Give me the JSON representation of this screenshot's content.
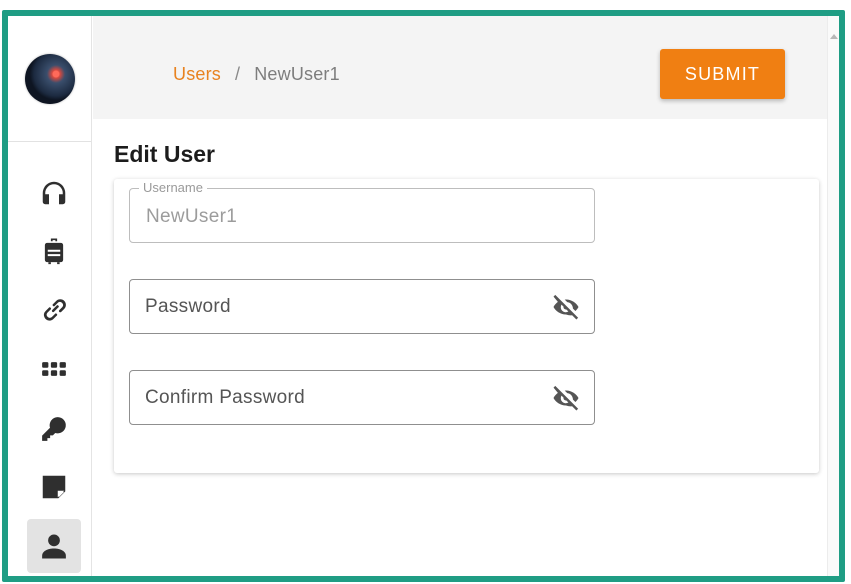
{
  "breadcrumb": {
    "root": "Users",
    "separator": "/",
    "current": "NewUser1"
  },
  "header": {
    "submit_label": "SUBMIT"
  },
  "page": {
    "title": "Edit User"
  },
  "form": {
    "username": {
      "label": "Username",
      "value": "NewUser1"
    },
    "password": {
      "placeholder": "Password",
      "value": ""
    },
    "confirm_password": {
      "placeholder": "Confirm Password",
      "value": ""
    }
  },
  "sidebar": {
    "items": [
      {
        "name": "headphones-icon",
        "active": false
      },
      {
        "name": "luggage-icon",
        "active": false
      },
      {
        "name": "link-icon",
        "active": false
      },
      {
        "name": "apps-grid-icon",
        "active": false
      },
      {
        "name": "key-icon",
        "active": false
      },
      {
        "name": "sticky-note-icon",
        "active": false
      },
      {
        "name": "user-icon",
        "active": true
      }
    ]
  },
  "colors": {
    "accent": "#f07f12",
    "frame": "#1f9d84",
    "link": "#e8821f"
  }
}
